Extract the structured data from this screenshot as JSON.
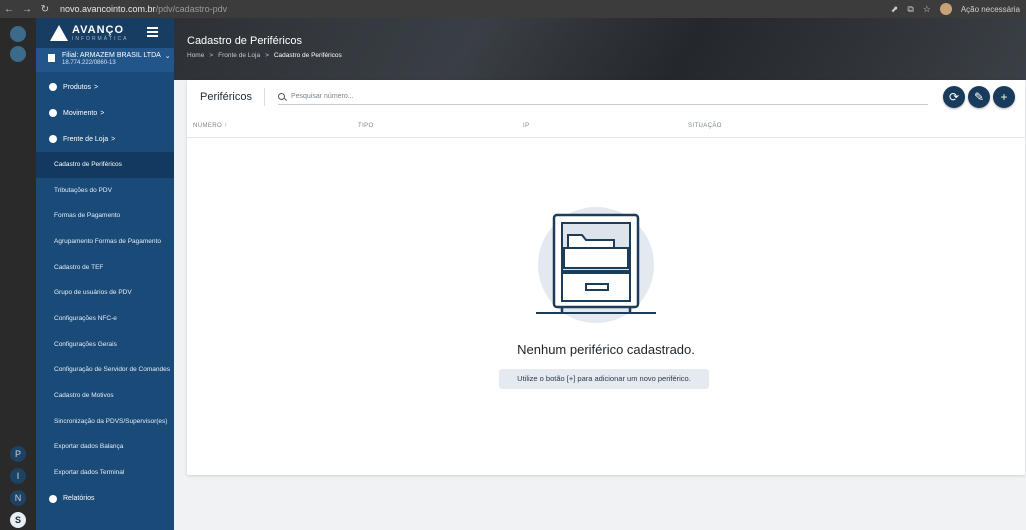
{
  "browser": {
    "url_host": "novo.avancointo.com.br",
    "url_path": "/pdv/cadastro-pdv",
    "action_label": "Ação necessária"
  },
  "brand": {
    "name": "AVANÇO",
    "subtitle": "INFORMÁTICA"
  },
  "filial": {
    "name": "Filial: ARMAZEM BRASIL LTDA",
    "doc": "18.774.222/0860-13"
  },
  "sidebar": {
    "top_items": [
      {
        "label": "Produtos",
        "chevron": ">"
      },
      {
        "label": "Movimento",
        "chevron": ">"
      },
      {
        "label": "Frente de Loja",
        "chevron": ">"
      }
    ],
    "sub_items": [
      "Cadastro de Periféricos",
      "Tributações do PDV",
      "Formas de Pagamento",
      "Agrupamento Formas de Pagamento",
      "Cadastro de TEF",
      "Grupo de usuários de PDV",
      "Configurações NFC-e",
      "Configurações Gerais",
      "Configuração de Servidor de Comandes",
      "Cadastro de Motivos",
      "Sincronização da PDVS/Supervisor(es)",
      "Exportar dados Balança",
      "Exportar dados Terminal"
    ],
    "bottom_item": "Relatórios"
  },
  "rail": {
    "letters": [
      "P",
      "I",
      "N",
      "S"
    ]
  },
  "header": {
    "title": "Cadastro de Periféricos",
    "breadcrumb": [
      "Home",
      "Fronte de Loja",
      "Cadastro de Periféricos"
    ],
    "separator": ">"
  },
  "card": {
    "tab_title": "Periféricos",
    "search_placeholder": "Pesquisar número...",
    "columns": [
      "NÚMERO",
      "TIPO",
      "IP",
      "SITUAÇÃO"
    ],
    "sort_arrow": "↑",
    "empty_title": "Nenhum periférico cadastrado.",
    "empty_hint": "Utilize o botão [+] para adicionar um novo periférico."
  },
  "icons": [
    "refresh-icon",
    "wrench-icon",
    "plus-icon",
    "search-icon"
  ],
  "colors": {
    "sidebar": "#1a4a78",
    "active": "#123a61",
    "fab": "#183b5c"
  }
}
